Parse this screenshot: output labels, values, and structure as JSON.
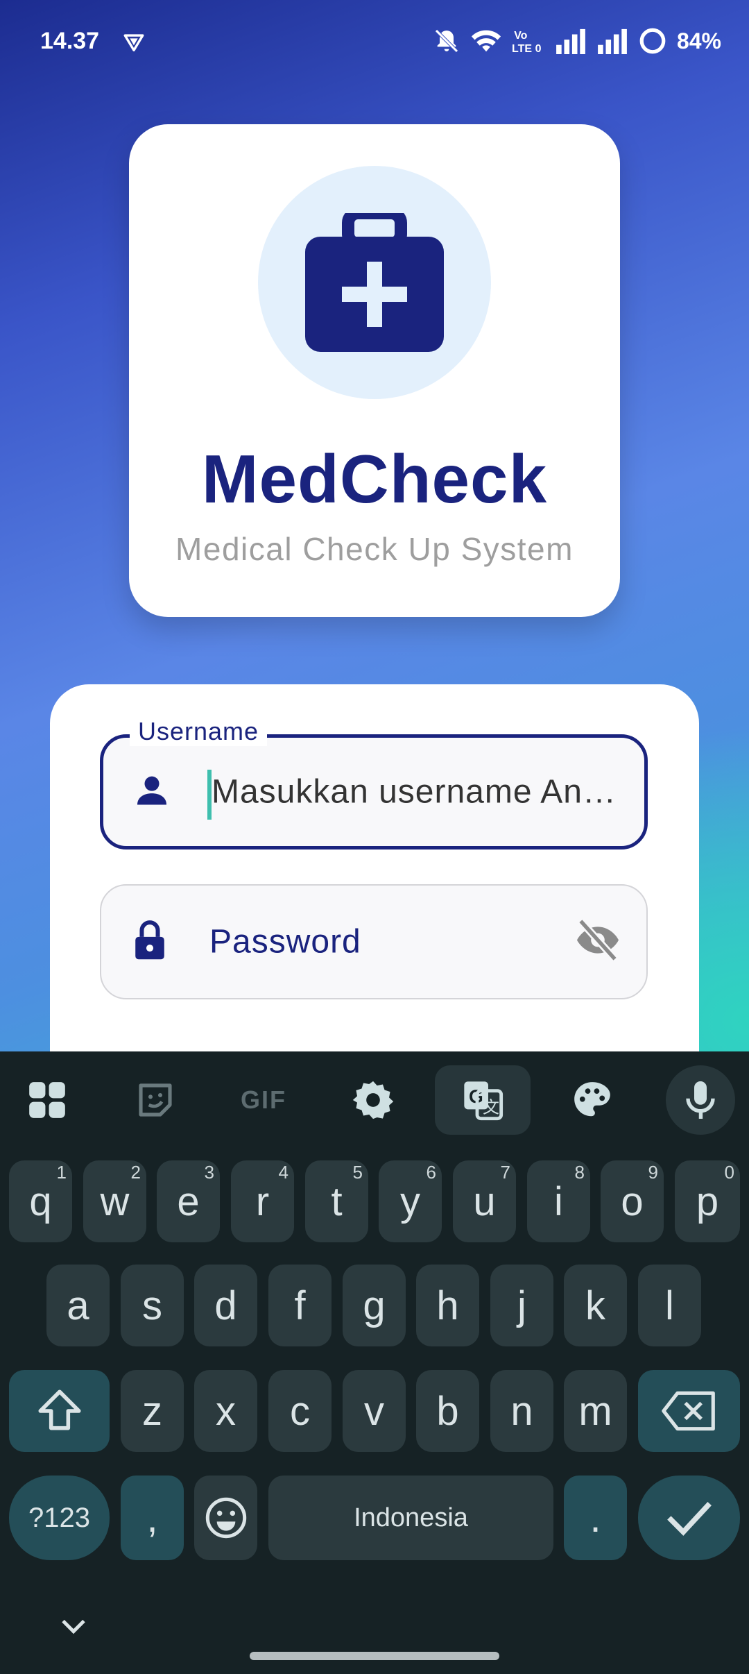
{
  "status_bar": {
    "time": "14.37",
    "battery": "84%",
    "icons": [
      "vpn-icon",
      "mute-icon",
      "wifi-icon",
      "volte-icon",
      "signal-icon",
      "signal-icon",
      "battery-icon"
    ]
  },
  "app": {
    "name": "MedCheck",
    "subtitle": "Medical Check Up System",
    "logo_icon": "medical-kit-icon",
    "primary_color": "#1a237e"
  },
  "login_form": {
    "username": {
      "label": "Username",
      "placeholder": "Masukkan username An…",
      "icon": "person-icon"
    },
    "password": {
      "placeholder": "Password",
      "icon": "lock-icon",
      "toggle_icon": "visibility-off-icon"
    }
  },
  "keyboard": {
    "toolbar": [
      "apps-grid-icon",
      "sticker-icon",
      "GIF",
      "settings-icon",
      "translate-icon",
      "theme-palette-icon",
      "microphone-icon"
    ],
    "gif_label": "GIF",
    "row1": [
      {
        "k": "q",
        "n": "1"
      },
      {
        "k": "w",
        "n": "2"
      },
      {
        "k": "e",
        "n": "3"
      },
      {
        "k": "r",
        "n": "4"
      },
      {
        "k": "t",
        "n": "5"
      },
      {
        "k": "y",
        "n": "6"
      },
      {
        "k": "u",
        "n": "7"
      },
      {
        "k": "i",
        "n": "8"
      },
      {
        "k": "o",
        "n": "9"
      },
      {
        "k": "p",
        "n": "0"
      }
    ],
    "row2": [
      "a",
      "s",
      "d",
      "f",
      "g",
      "h",
      "j",
      "k",
      "l"
    ],
    "row3": [
      "z",
      "x",
      "c",
      "v",
      "b",
      "n",
      "m"
    ],
    "symbols_label": "?123",
    "comma_label": ",",
    "space_label": "Indonesia",
    "period_label": ".",
    "colors": {
      "background": "#162225",
      "key": "#2b3a3e",
      "function_key": "#244e58"
    }
  }
}
